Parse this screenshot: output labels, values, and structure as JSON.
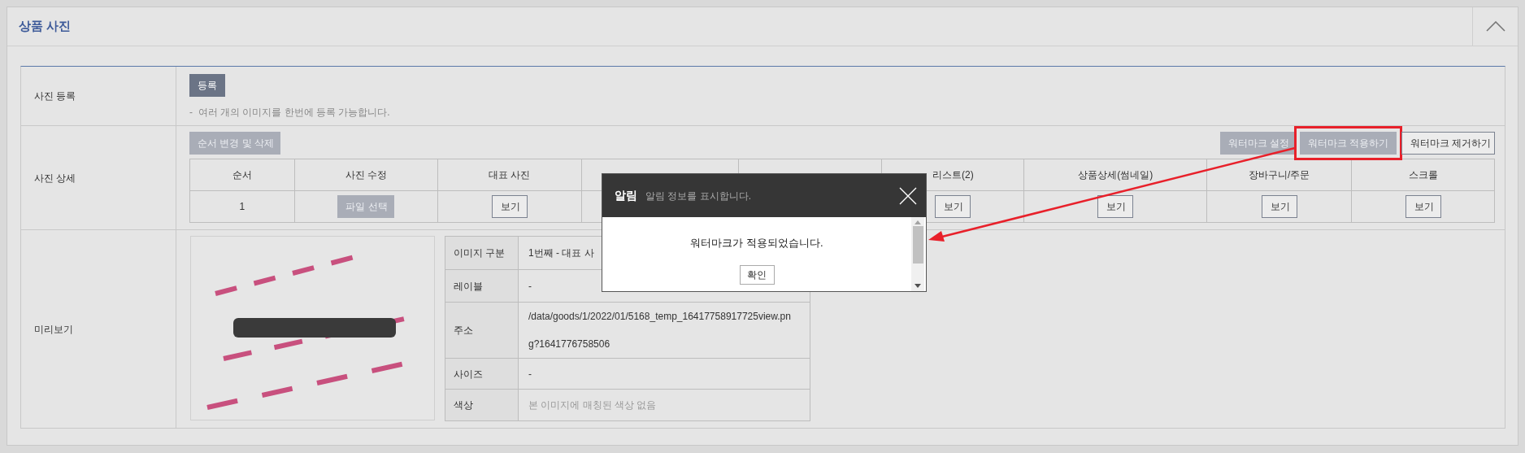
{
  "panel": {
    "title": "상품 사진"
  },
  "register": {
    "label": "사진 등록",
    "button": "등록",
    "note": "-  여러 개의 이미지를 한번에 등록 가능합니다."
  },
  "detail": {
    "label": "사진 상세",
    "reorder_button": "순서 변경 및 삭제",
    "watermark_buttons": [
      {
        "label": "워터마크 설정",
        "kind": "muted",
        "highlighted": false
      },
      {
        "label": "워터마크 적용하기",
        "kind": "muted",
        "highlighted": true
      },
      {
        "label": "워터마크 제거하기",
        "kind": "outline",
        "highlighted": false
      }
    ],
    "columns": [
      {
        "kind": "text",
        "label": "순서"
      },
      {
        "kind": "text",
        "label": "사진 수정"
      },
      {
        "kind": "text",
        "label": "대표 사진"
      },
      {
        "kind": "covered"
      },
      {
        "kind": "covered"
      },
      {
        "kind": "text",
        "label": "리스트(2)"
      },
      {
        "kind": "text",
        "label": "상품상세(썸네일)"
      },
      {
        "kind": "text",
        "label": "장바구니/주문"
      },
      {
        "kind": "text",
        "label": "스크롤"
      }
    ],
    "rows": [
      {
        "cells": [
          {
            "kind": "text",
            "text": "1"
          },
          {
            "kind": "file_button",
            "text": "파일 선택"
          },
          {
            "kind": "view_button",
            "text": "보기"
          },
          {
            "kind": "covered"
          },
          {
            "kind": "covered"
          },
          {
            "kind": "view_button",
            "text": "보기"
          },
          {
            "kind": "view_button",
            "text": "보기"
          },
          {
            "kind": "view_button",
            "text": "보기"
          },
          {
            "kind": "view_button",
            "text": "보기"
          }
        ]
      }
    ]
  },
  "preview": {
    "label": "미리보기",
    "info": [
      {
        "label": "이미지 구분",
        "value": "1번째 - 대표 사",
        "muted": false
      },
      {
        "label": "레이블",
        "value": "-",
        "muted": false
      },
      {
        "label": "주소",
        "value": "/data/goods/1/2022/01/5168_temp_16417758917725view.png?1641776758506",
        "muted": false
      },
      {
        "label": "사이즈",
        "value": "-",
        "muted": false
      },
      {
        "label": "색상",
        "value": "본 이미지에 매칭된 색상 없음",
        "muted": true
      }
    ]
  },
  "modal": {
    "title": "알림",
    "subtitle": "알림 정보를 표시합니다.",
    "message": "워터마크가 적용되었습니다.",
    "button": "확인"
  }
}
